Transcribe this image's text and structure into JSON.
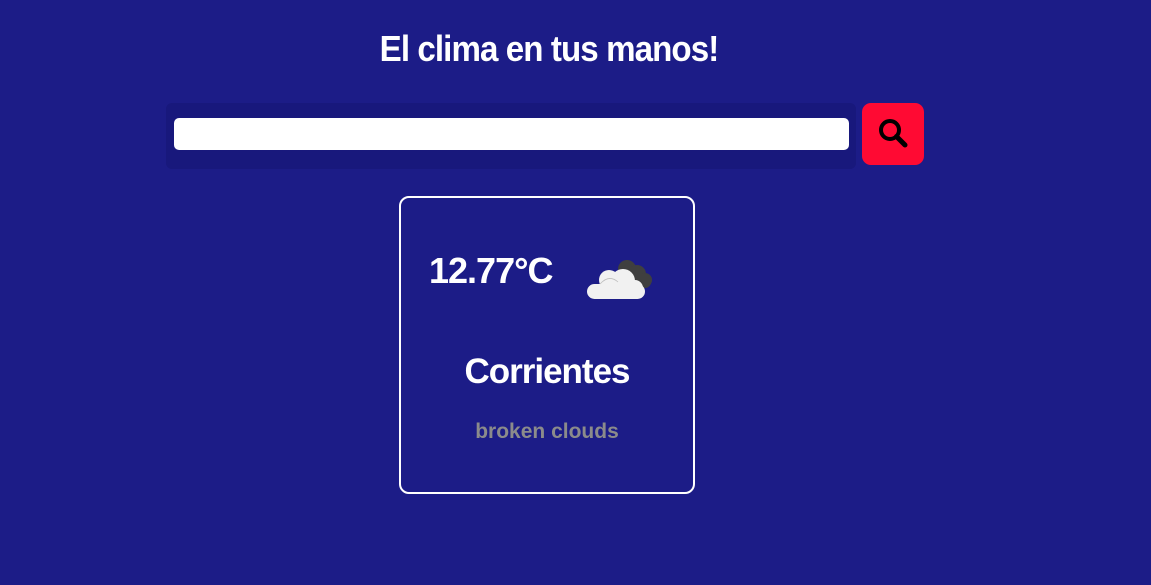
{
  "header": {
    "title": "El clima en tus manos!"
  },
  "search": {
    "value": "",
    "placeholder": "",
    "button_icon": "search-icon"
  },
  "weather_card": {
    "temperature": "12.77°C",
    "icon": "broken-clouds-icon",
    "city": "Corrientes",
    "description": "broken clouds"
  },
  "colors": {
    "background": "#1c1c87",
    "search_button": "#ff0a33",
    "text": "#ffffff",
    "description_text": "#8b8b8b"
  }
}
